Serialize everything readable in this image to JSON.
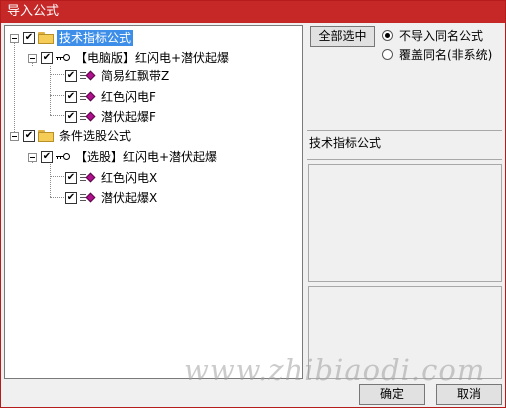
{
  "window": {
    "title": "导入公式"
  },
  "tree": {
    "group1": {
      "label": "技术指标公式",
      "sub_label": "【电脑版】红闪电+潜伏起爆",
      "items": [
        "简易红飘带Z",
        "红色闪电F",
        "潜伏起爆F"
      ]
    },
    "group2": {
      "label": "条件选股公式",
      "sub_label": "【选股】红闪电+潜伏起爆",
      "items": [
        "红色闪电X",
        "潜伏起爆X"
      ]
    },
    "check_mark": "✔"
  },
  "controls": {
    "select_all": "全部选中",
    "option_no_import": "不导入同名公式",
    "option_overwrite": "覆盖同名(非系统)",
    "info_label": "技术指标公式"
  },
  "footer": {
    "ok": "确定",
    "cancel": "取消",
    "watermark": "www.zhibiaodi.com"
  }
}
